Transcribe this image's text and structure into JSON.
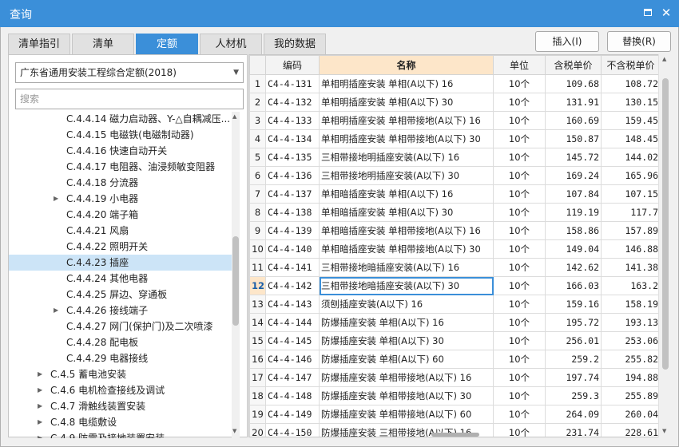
{
  "window": {
    "title": "查询"
  },
  "tabs": [
    {
      "label": "清单指引",
      "active": false
    },
    {
      "label": "清单",
      "active": false
    },
    {
      "label": "定额",
      "active": true
    },
    {
      "label": "人材机",
      "active": false
    },
    {
      "label": "我的数据",
      "active": false
    }
  ],
  "actions": {
    "insert_label": "插入(I)",
    "replace_label": "替换(R)"
  },
  "left": {
    "dropdown_value": "广东省通用安装工程综合定额(2018)",
    "search_placeholder": "搜索",
    "tree": [
      {
        "label": "C.4.4.14 磁力启动器、Y-△自耦减压...",
        "level": 3,
        "expandable": false,
        "selected": false
      },
      {
        "label": "C.4.4.15 电磁铁(电磁制动器)",
        "level": 3,
        "expandable": false,
        "selected": false
      },
      {
        "label": "C.4.4.16 快速自动开关",
        "level": 3,
        "expandable": false,
        "selected": false
      },
      {
        "label": "C.4.4.17 电阻器、油浸频敏变阻器",
        "level": 3,
        "expandable": false,
        "selected": false
      },
      {
        "label": "C.4.4.18 分流器",
        "level": 3,
        "expandable": false,
        "selected": false
      },
      {
        "label": "C.4.4.19 小电器",
        "level": 3,
        "expandable": true,
        "selected": false
      },
      {
        "label": "C.4.4.20 端子箱",
        "level": 3,
        "expandable": false,
        "selected": false
      },
      {
        "label": "C.4.4.21 风扇",
        "level": 3,
        "expandable": false,
        "selected": false
      },
      {
        "label": "C.4.4.22 照明开关",
        "level": 3,
        "expandable": false,
        "selected": false
      },
      {
        "label": "C.4.4.23 插座",
        "level": 3,
        "expandable": false,
        "selected": true
      },
      {
        "label": "C.4.4.24 其他电器",
        "level": 3,
        "expandable": false,
        "selected": false
      },
      {
        "label": "C.4.4.25 屏边、穿通板",
        "level": 3,
        "expandable": false,
        "selected": false
      },
      {
        "label": "C.4.4.26 接线端子",
        "level": 3,
        "expandable": true,
        "selected": false
      },
      {
        "label": "C.4.4.27 网门(保护门)及二次喷漆",
        "level": 3,
        "expandable": false,
        "selected": false
      },
      {
        "label": "C.4.4.28 配电板",
        "level": 3,
        "expandable": false,
        "selected": false
      },
      {
        "label": "C.4.4.29 电器接线",
        "level": 3,
        "expandable": false,
        "selected": false
      },
      {
        "label": "C.4.5 蓄电池安装",
        "level": 2,
        "expandable": true,
        "selected": false
      },
      {
        "label": "C.4.6 电机检查接线及调试",
        "level": 2,
        "expandable": true,
        "selected": false
      },
      {
        "label": "C.4.7 滑触线装置安装",
        "level": 2,
        "expandable": true,
        "selected": false
      },
      {
        "label": "C.4.8 电缆敷设",
        "level": 2,
        "expandable": true,
        "selected": false
      },
      {
        "label": "C.4.9 防雷及接地装置安装",
        "level": 2,
        "expandable": true,
        "selected": false
      }
    ]
  },
  "grid": {
    "headers": {
      "code": "编码",
      "name": "名称",
      "unit": "单位",
      "tax_price": "含税单价",
      "notax_price": "不含税单价"
    },
    "current_row": 12,
    "rows": [
      {
        "no": "1",
        "code": "C4-4-131",
        "name": "单相明插座安装 单相(A以下) 16",
        "unit": "10个",
        "tax": "109.68",
        "notax": "108.72"
      },
      {
        "no": "2",
        "code": "C4-4-132",
        "name": "单相明插座安装 单相(A以下) 30",
        "unit": "10个",
        "tax": "131.91",
        "notax": "130.15"
      },
      {
        "no": "3",
        "code": "C4-4-133",
        "name": "单相明插座安装 单相带接地(A以下) 16",
        "unit": "10个",
        "tax": "160.69",
        "notax": "159.45"
      },
      {
        "no": "4",
        "code": "C4-4-134",
        "name": "单相明插座安装 单相带接地(A以下) 30",
        "unit": "10个",
        "tax": "150.87",
        "notax": "148.45"
      },
      {
        "no": "5",
        "code": "C4-4-135",
        "name": "三相带接地明插座安装(A以下) 16",
        "unit": "10个",
        "tax": "145.72",
        "notax": "144.02"
      },
      {
        "no": "6",
        "code": "C4-4-136",
        "name": "三相带接地明插座安装(A以下) 30",
        "unit": "10个",
        "tax": "169.24",
        "notax": "165.96"
      },
      {
        "no": "7",
        "code": "C4-4-137",
        "name": "单相暗插座安装 单相(A以下) 16",
        "unit": "10个",
        "tax": "107.84",
        "notax": "107.15"
      },
      {
        "no": "8",
        "code": "C4-4-138",
        "name": "单相暗插座安装 单相(A以下) 30",
        "unit": "10个",
        "tax": "119.19",
        "notax": "117.7"
      },
      {
        "no": "9",
        "code": "C4-4-139",
        "name": "单相暗插座安装 单相带接地(A以下) 16",
        "unit": "10个",
        "tax": "158.86",
        "notax": "157.89"
      },
      {
        "no": "10",
        "code": "C4-4-140",
        "name": "单相暗插座安装 单相带接地(A以下) 30",
        "unit": "10个",
        "tax": "149.04",
        "notax": "146.88"
      },
      {
        "no": "11",
        "code": "C4-4-141",
        "name": "三相带接地暗插座安装(A以下) 16",
        "unit": "10个",
        "tax": "142.62",
        "notax": "141.38"
      },
      {
        "no": "12",
        "code": "C4-4-142",
        "name": "三相带接地暗插座安装(A以下) 30",
        "unit": "10个",
        "tax": "166.03",
        "notax": "163.2"
      },
      {
        "no": "13",
        "code": "C4-4-143",
        "name": "须刨插座安装(A以下) 16",
        "unit": "10个",
        "tax": "159.16",
        "notax": "158.19"
      },
      {
        "no": "14",
        "code": "C4-4-144",
        "name": "防爆插座安装 单相(A以下) 16",
        "unit": "10个",
        "tax": "195.72",
        "notax": "193.13"
      },
      {
        "no": "15",
        "code": "C4-4-145",
        "name": "防爆插座安装 单相(A以下) 30",
        "unit": "10个",
        "tax": "256.01",
        "notax": "253.06"
      },
      {
        "no": "16",
        "code": "C4-4-146",
        "name": "防爆插座安装 单相(A以下) 60",
        "unit": "10个",
        "tax": "259.2",
        "notax": "255.82"
      },
      {
        "no": "17",
        "code": "C4-4-147",
        "name": "防爆插座安装 单相带接地(A以下) 16",
        "unit": "10个",
        "tax": "197.74",
        "notax": "194.88"
      },
      {
        "no": "18",
        "code": "C4-4-148",
        "name": "防爆插座安装 单相带接地(A以下) 30",
        "unit": "10个",
        "tax": "259.3",
        "notax": "255.89"
      },
      {
        "no": "19",
        "code": "C4-4-149",
        "name": "防爆插座安装 单相带接地(A以下) 60",
        "unit": "10个",
        "tax": "264.09",
        "notax": "260.04"
      },
      {
        "no": "20",
        "code": "C4-4-150",
        "name": "防爆插座安装 三相带接地(A以下) 16",
        "unit": "10个",
        "tax": "231.74",
        "notax": "228.61"
      }
    ]
  },
  "colors": {
    "accent": "#3b8fd9",
    "header_highlight": "#fde6c9",
    "selected_tree": "#cce4f7"
  }
}
